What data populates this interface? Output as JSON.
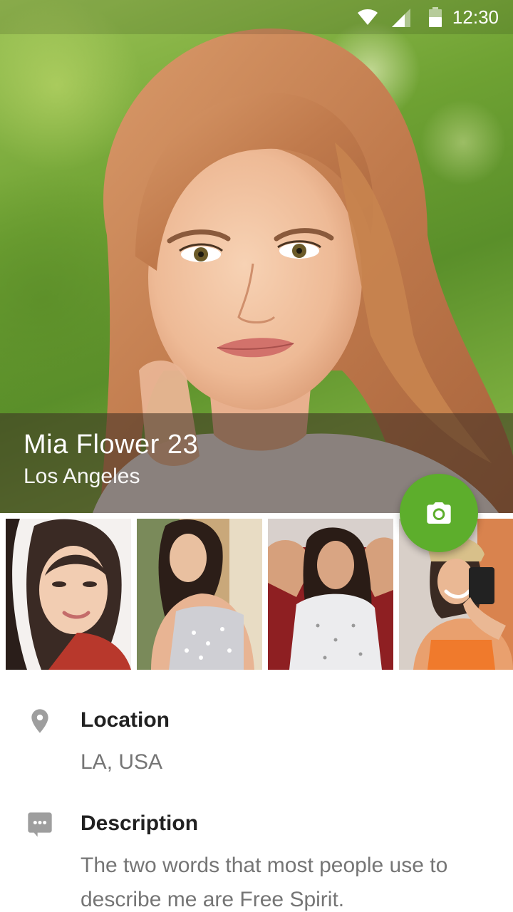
{
  "status_bar": {
    "time": "12:30",
    "icons": [
      "wifi-icon",
      "cell-signal-icon",
      "battery-icon"
    ]
  },
  "profile": {
    "name_age": "Mia Flower 23",
    "city": "Los Angeles"
  },
  "actions": {
    "camera_button_icon": "camera-icon"
  },
  "gallery": {
    "photo_count": 4
  },
  "details": {
    "location": {
      "label": "Location",
      "value": "LA, USA",
      "icon": "location-pin-icon"
    },
    "description": {
      "label": "Description",
      "value": "The two words that most people use to describe me are Free Spirit.",
      "icon": "comment-icon"
    }
  },
  "colors": {
    "accent": "#5dae2c",
    "primary_text": "#212121",
    "secondary_text": "#757575",
    "icon_grey": "#9e9e9e"
  }
}
